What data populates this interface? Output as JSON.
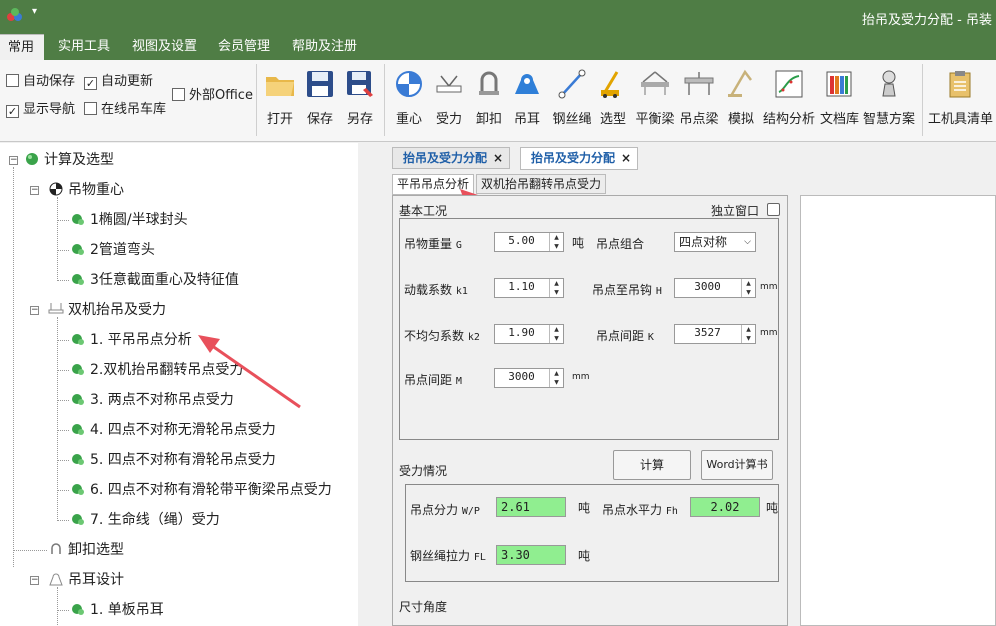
{
  "window": {
    "title": "抬吊及受力分配 - 吊装"
  },
  "menu": {
    "items": [
      "常用",
      "实用工具",
      "视图及设置",
      "会员管理",
      "帮助及注册"
    ]
  },
  "ribbon": {
    "checks": [
      {
        "label": "自动保存",
        "checked": false
      },
      {
        "label": "自动更新",
        "checked": true
      },
      {
        "label": "外部Office",
        "checked": false
      },
      {
        "label": "显示导航",
        "checked": true
      },
      {
        "label": "在线吊车库",
        "checked": false
      }
    ],
    "file_buttons": [
      "打开",
      "保存",
      "另存"
    ],
    "tool_buttons": [
      "重心",
      "受力",
      "卸扣",
      "吊耳",
      "钢丝绳",
      "选型",
      "平衡梁",
      "吊点梁",
      "模拟",
      "结构分析",
      "文档库",
      "智慧方案"
    ],
    "extra_buttons": [
      "工机具清单"
    ]
  },
  "tree": {
    "root": "计算及选型",
    "cog": "吊物重心",
    "cog_items": [
      "1椭圆/半球封头",
      "2管道弯头",
      "3任意截面重心及特征值"
    ],
    "dual": "双机抬吊及受力",
    "dual_items": [
      "1. 平吊吊点分析",
      "2.双机抬吊翻转吊点受力",
      "3. 两点不对称吊点受力",
      "4. 四点不对称无滑轮吊点受力",
      "5. 四点不对称有滑轮吊点受力",
      "6. 四点不对称有滑轮带平衡梁吊点受力",
      "7. 生命线（绳）受力"
    ],
    "shackle": "卸扣选型",
    "lug": "吊耳设计",
    "lug_items": [
      "1. 单板吊耳"
    ]
  },
  "doc_tabs": [
    {
      "label": "抬吊及受力分配",
      "close": "×"
    },
    {
      "label": "抬吊及受力分配",
      "close": "×"
    }
  ],
  "sub_tabs": [
    "平吊吊点分析",
    "双机抬吊翻转吊点受力"
  ],
  "form": {
    "basic_title": "基本工况",
    "standalone": "独立窗口",
    "weight_label": "吊物重量",
    "weight_sym": "G",
    "weight_value": "5.00",
    "weight_unit": "吨",
    "combo_label": "吊点组合",
    "combo_value": "四点对称",
    "k1_label": "动载系数",
    "k1_sym": "k1",
    "k1_value": "1.10",
    "hook_label": "吊点至吊钩",
    "hook_sym": "H",
    "hook_value": "3000",
    "hook_unit": "mm",
    "k2_label": "不均匀系数",
    "k2_sym": "k2",
    "k2_value": "1.90",
    "spacing_k_label": "吊点间距",
    "spacing_k_sym": "K",
    "spacing_k_value": "3527",
    "spacing_k_unit": "mm",
    "spacing_m_label": "吊点间距",
    "spacing_m_sym": "M",
    "spacing_m_value": "3000",
    "spacing_m_unit": "mm",
    "force_title": "受力情况",
    "calc_button": "计算",
    "word_button": "Word计算书",
    "wp_label": "吊点分力",
    "wp_sym": "W/P",
    "wp_value": "2.61",
    "wp_unit": "吨",
    "fh_label": "吊点水平力",
    "fh_sym": "Fh",
    "fh_value": "2.02",
    "fh_unit": "吨",
    "fl_label": "钢丝绳拉力",
    "fl_sym": "FL",
    "fl_value": "3.30",
    "fl_unit": "吨",
    "angle_title": "尺寸角度"
  },
  "colors": {
    "titlebar": "#4f7d45",
    "doc_tab_text": "#1f5fa8",
    "result_bg": "#90ee90",
    "arrow": "#e8505b"
  }
}
